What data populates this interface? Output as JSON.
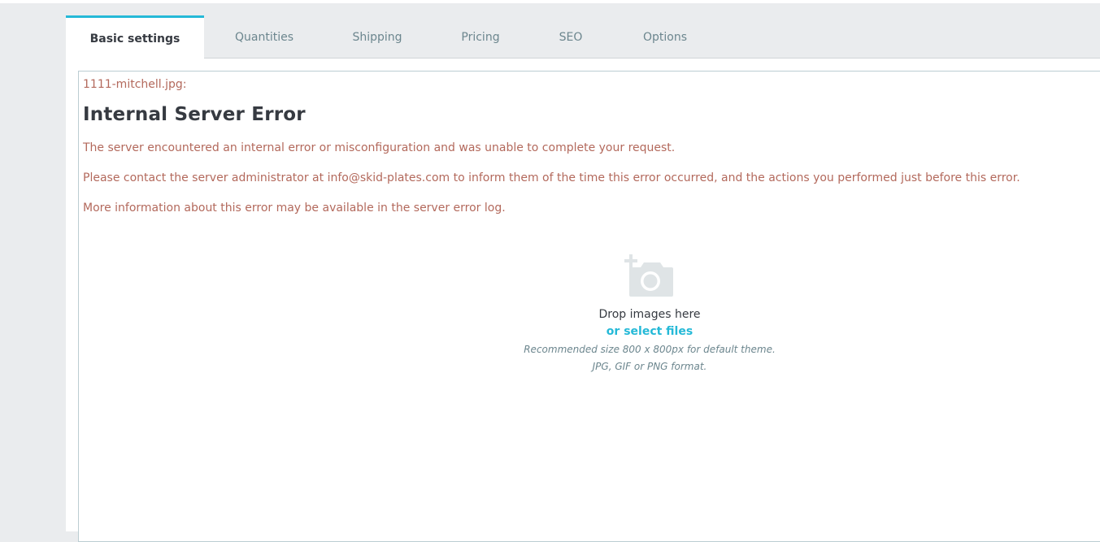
{
  "tabs": [
    {
      "label": "Basic settings",
      "active": true
    },
    {
      "label": "Quantities",
      "active": false
    },
    {
      "label": "Shipping",
      "active": false
    },
    {
      "label": "Pricing",
      "active": false
    },
    {
      "label": "SEO",
      "active": false
    },
    {
      "label": "Options",
      "active": false
    }
  ],
  "error": {
    "filename": "1111-mitchell.jpg:",
    "title": "Internal Server Error",
    "line1": "The server encountered an internal error or misconfiguration and was unable to complete your request.",
    "line2": "Please contact the server administrator at info@skid-plates.com to inform them of the time this error occurred, and the actions you performed just before this error.",
    "line3": "More information about this error may be available in the server error log."
  },
  "dropzone": {
    "icon": "add-photo-icon",
    "drop_text": "Drop images here",
    "select_label": "or select files",
    "hint_size": "Recommended size 800 x 800px for default theme.",
    "hint_format": "JPG, GIF or PNG format."
  },
  "colors": {
    "accent": "#25b9d7",
    "error_text": "#b3695c",
    "tab_inactive": "#6c868e",
    "tab_bar_bg": "#eaecee",
    "icon_gray": "#dfe4e6"
  }
}
